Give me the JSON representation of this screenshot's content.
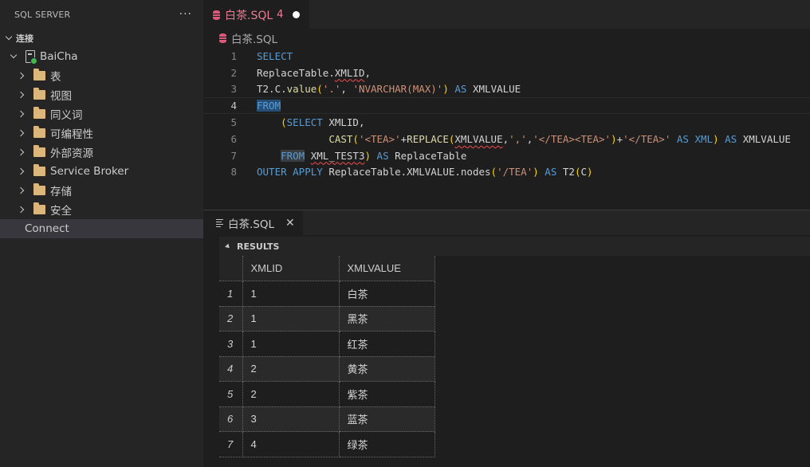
{
  "sidebar": {
    "title": "SQL SERVER",
    "more": "···",
    "section": "连接",
    "server": "BaiCha",
    "folders": [
      "表",
      "视图",
      "同义词",
      "可编程性",
      "外部资源",
      "Service Broker",
      "存储",
      "安全"
    ],
    "connect": "Connect"
  },
  "editor": {
    "tab": {
      "label": "白茶.SQL",
      "count": "4"
    },
    "breadcrumb": "白茶.SQL",
    "line_numbers": [
      "1",
      "2",
      "3",
      "4",
      "5",
      "6",
      "7",
      "8"
    ],
    "code": {
      "l1": {
        "kw": "SELECT"
      },
      "l2": {
        "a": "ReplaceTable.",
        "b": "XMLID",
        "c": ","
      },
      "l3": {
        "a": "T2.C.",
        "fn": "value",
        "p1": "(",
        "s1": "'.'",
        "sep": ", ",
        "s2": "'NVARCHAR(MAX)'",
        "p2": ")",
        "as": "AS",
        "col": "XMLVALUE"
      },
      "l4": {
        "kw": "FROM"
      },
      "l5": {
        "indent": "    ",
        "p": "(",
        "kw": "SELECT",
        "col": "XMLID",
        "c": ","
      },
      "l6": {
        "indent": "            ",
        "fn": "CAST",
        "p1": "(",
        "s1": "'<TEA>'",
        "plus1": "+",
        "fn2": "REPLACE",
        "p2": "(",
        "x": "XMLVALUE",
        "sep": ",",
        "s2": "','",
        "sep2": ",",
        "s3": "'</TEA><TEA>'",
        "p3": ")",
        "plus2": "+",
        "s4": "'</TEA>'",
        "as": "AS",
        "kw": "XML",
        "p4": ")",
        "as2": "AS",
        "col": "XMLVALUE"
      },
      "l7": {
        "indent": "    ",
        "kw": "FROM",
        "tbl": "XML_TEST3",
        "p": ")",
        "as": "AS",
        "alias": "ReplaceTable"
      },
      "l8": {
        "kw": "OUTER APPLY",
        "a": "ReplaceTable.XMLVALUE.",
        "fn": "nodes",
        "p1": "(",
        "s": "'/TEA'",
        "p2": ")",
        "as": "AS",
        "t": "T2",
        "p3": "(",
        "c": "C",
        "p4": ")"
      }
    }
  },
  "panel": {
    "tab": "白茶.SQL",
    "results_label": "RESULTS",
    "columns": [
      "XMLID",
      "XMLVALUE"
    ],
    "rows": [
      {
        "n": "1",
        "id": "1",
        "val": "白茶"
      },
      {
        "n": "2",
        "id": "1",
        "val": "黑茶"
      },
      {
        "n": "3",
        "id": "1",
        "val": "红茶"
      },
      {
        "n": "4",
        "id": "2",
        "val": "黄茶"
      },
      {
        "n": "5",
        "id": "2",
        "val": "紫茶"
      },
      {
        "n": "6",
        "id": "3",
        "val": "蓝茶"
      },
      {
        "n": "7",
        "id": "4",
        "val": "绿茶"
      }
    ]
  },
  "colors": {
    "keyword": "#569cd6",
    "function": "#dcdcaa",
    "string": "#ce9178",
    "bracket": "#ffd700",
    "tab_modified": "#e87d94",
    "db_icon": "#e05779",
    "folder": "#dcb67a",
    "connected": "#3fb950"
  },
  "icons": [
    "database-icon",
    "folder-icon",
    "server-icon",
    "document-icon",
    "close-icon",
    "chevron-right-icon",
    "chevron-down-icon",
    "more-icon"
  ]
}
